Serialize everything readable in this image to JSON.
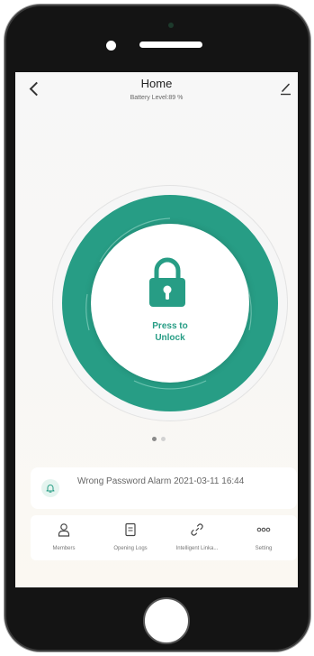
{
  "header": {
    "title": "Home",
    "battery_label": "Battery Level:89 %"
  },
  "unlock": {
    "line1": "Press to",
    "line2": "Unlock"
  },
  "pager": {
    "count": 2,
    "active": 1
  },
  "alarm": {
    "text": "Wrong Password Alarm 2021-03-11 16:44"
  },
  "tabs": [
    {
      "label": "Members",
      "icon": "person-icon"
    },
    {
      "label": "Opening Logs",
      "icon": "document-icon"
    },
    {
      "label": "Intelligent Linka...",
      "icon": "link-icon"
    },
    {
      "label": "Setting",
      "icon": "more-dots-icon"
    }
  ],
  "colors": {
    "accent": "#279d85",
    "accent_light": "#e4f4ef"
  }
}
